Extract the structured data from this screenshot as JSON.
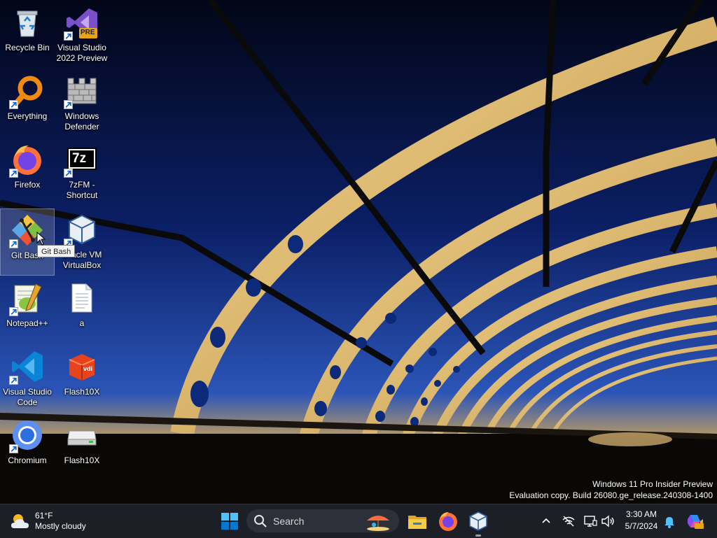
{
  "desktop": {
    "icons": [
      {
        "label": "Recycle Bin",
        "icon": "recycle-bin-icon"
      },
      {
        "label": "Visual Studio\n2022 Preview",
        "icon": "visual-studio-preview-icon",
        "badge": "PRE"
      },
      {
        "label": "Everything",
        "icon": "everything-search-icon"
      },
      {
        "label": "Windows\nDefender",
        "icon": "windows-defender-icon"
      },
      {
        "label": "Firefox",
        "icon": "firefox-icon"
      },
      {
        "label": "7zFM -\nShortcut",
        "icon": "7zip-icon",
        "glyph": "7z"
      },
      {
        "label": "Git Bash",
        "icon": "git-bash-icon"
      },
      {
        "label": "Oracle VM\nVirtualBox",
        "icon": "virtualbox-icon"
      },
      {
        "label": "Notepad++",
        "icon": "notepad-plus-plus-icon"
      },
      {
        "label": "a",
        "icon": "text-file-icon"
      },
      {
        "label": "Visual Studio\nCode",
        "icon": "vscode-icon"
      },
      {
        "label": "Flash10X",
        "icon": "flash10x-icon",
        "glyph": "vdi"
      },
      {
        "label": "Chromium",
        "icon": "chromium-icon"
      },
      {
        "label": "Flash10X",
        "icon": "drive-icon"
      }
    ],
    "selected_icon": "Git Bash",
    "tooltip": "Git Bash"
  },
  "watermark": {
    "line1": "Windows 11 Pro Insider Preview",
    "line2": "Evaluation copy. Build 26080.ge_release.240308-1400"
  },
  "taskbar": {
    "weather": {
      "temp": "61°F",
      "condition": "Mostly cloudy",
      "icon": "partly-cloudy-icon"
    },
    "search_placeholder": "Search",
    "pinned_apps": [
      "file-explorer-icon",
      "firefox-icon",
      "virtualbox-icon"
    ],
    "tray_icons": [
      "chevron-up-icon",
      "network-off-icon",
      "display-icon",
      "volume-icon"
    ],
    "clock": {
      "time": "3:30 AM",
      "date": "5/7/2024"
    },
    "colors": {
      "background": "#1c1f26",
      "search": "#2d3038",
      "accent": "#0078d4"
    }
  }
}
